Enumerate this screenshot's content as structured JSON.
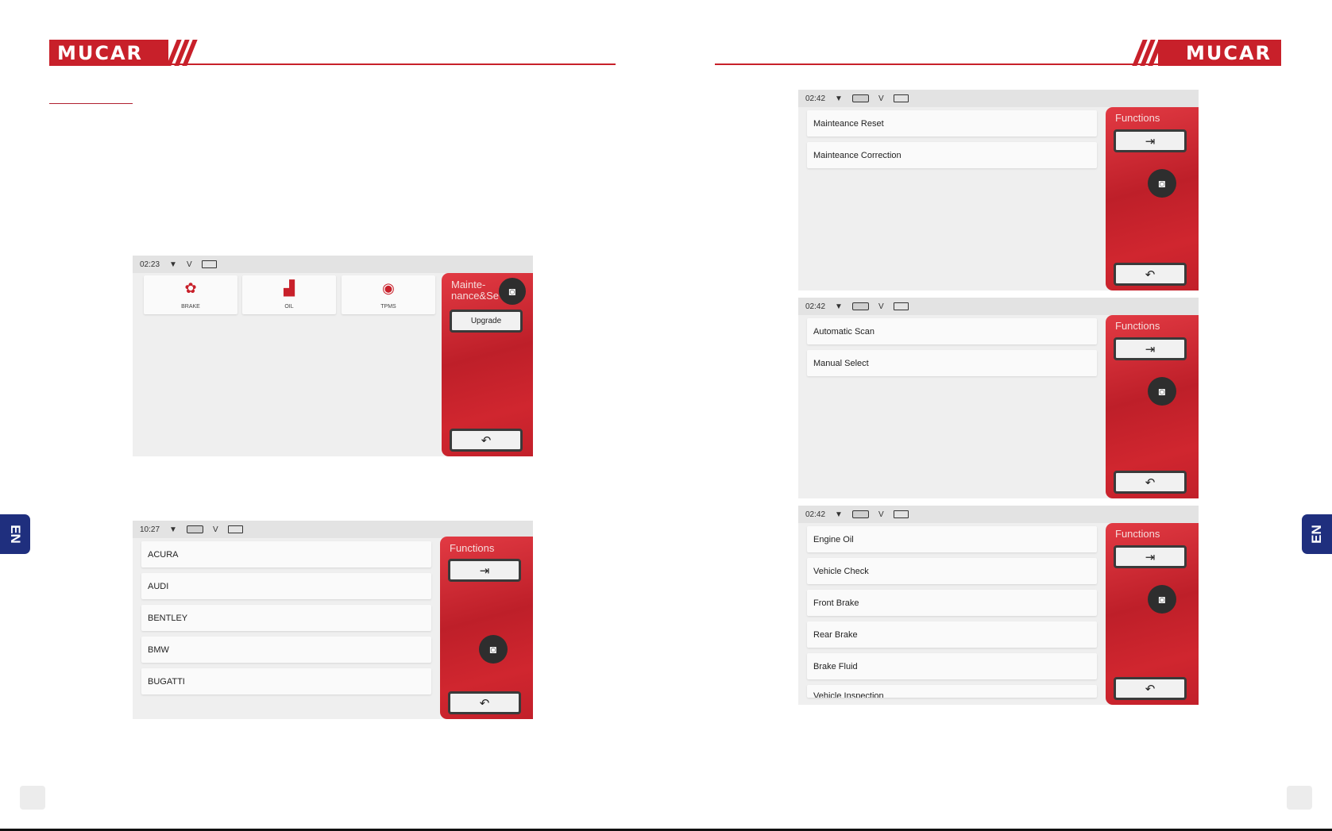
{
  "brand": {
    "logo_text": "MUCAR"
  },
  "side_tab_label": "EN",
  "icons": {
    "wifi": "wifi-icon",
    "exit": "exit-icon",
    "camera": "camera-icon",
    "back": "back-icon",
    "brake": "brake-icon",
    "oil": "oil-can-icon",
    "tpms": "tpms-icon"
  },
  "colors": {
    "brand_red": "#c8202a",
    "tab_blue": "#1f2f7e"
  },
  "screen1": {
    "time": "02:23",
    "voltage": "V",
    "tiles": [
      {
        "label": "BRAKE"
      },
      {
        "label": "OIL"
      },
      {
        "label": "TPMS"
      }
    ],
    "panel_title": "Mainte-nance&Se",
    "upgrade_label": "Upgrade"
  },
  "screen2": {
    "time": "10:27",
    "voltage": "V",
    "panel_title": "Functions",
    "items": [
      "ACURA",
      "AUDI",
      "BENTLEY",
      "BMW",
      "BUGATTI"
    ]
  },
  "screen3": {
    "time": "02:42",
    "voltage": "V",
    "panel_title": "Functions",
    "items": [
      "Mainteance Reset",
      "Mainteance Correction"
    ]
  },
  "screen4": {
    "time": "02:42",
    "voltage": "V",
    "panel_title": "Functions",
    "items": [
      "Automatic Scan",
      "Manual Select"
    ]
  },
  "screen5": {
    "time": "02:42",
    "voltage": "V",
    "panel_title": "Functions",
    "items": [
      "Engine Oil",
      "Vehicle Check",
      "Front Brake",
      "Rear Brake",
      "Brake Fluid",
      "Vehicle Inspection"
    ]
  }
}
